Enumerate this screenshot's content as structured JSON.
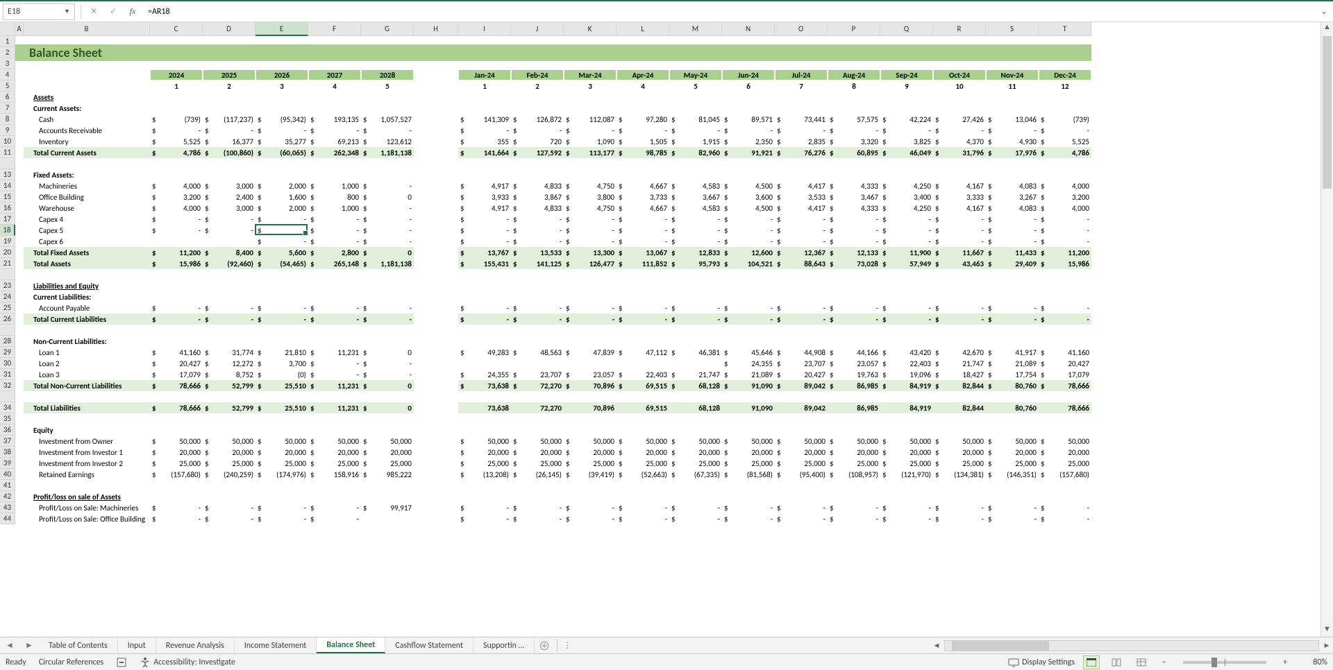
{
  "selection": {
    "cell_ref": "E18",
    "formula": "=AR18"
  },
  "column_headers": [
    "A",
    "B",
    "C",
    "D",
    "E",
    "F",
    "G",
    "H",
    "I",
    "J",
    "K",
    "L",
    "M",
    "N",
    "O",
    "P",
    "Q",
    "R",
    "S",
    "T"
  ],
  "row_headers": [
    1,
    2,
    3,
    4,
    5,
    6,
    7,
    8,
    9,
    10,
    11,
    "",
    13,
    14,
    15,
    16,
    17,
    18,
    19,
    20,
    21,
    "",
    23,
    24,
    25,
    26,
    "",
    28,
    29,
    30,
    31,
    32,
    "",
    34,
    35,
    36,
    37,
    38,
    39,
    40,
    41,
    42,
    43,
    44
  ],
  "title": "Balance Sheet",
  "yearly": {
    "headers": [
      "2024",
      "2025",
      "2026",
      "2027",
      "2028"
    ],
    "indices": [
      "1",
      "2",
      "3",
      "4",
      "5"
    ]
  },
  "monthly": {
    "headers": [
      "Jan-24",
      "Feb-24",
      "Mar-24",
      "Apr-24",
      "May-24",
      "Jun-24",
      "Jul-24",
      "Aug-24",
      "Sep-24",
      "Oct-24",
      "Nov-24",
      "Dec-24"
    ],
    "indices": [
      "1",
      "2",
      "3",
      "4",
      "5",
      "6",
      "7",
      "8",
      "9",
      "10",
      "11",
      "12"
    ]
  },
  "sections": {
    "assets": "Assets",
    "current_assets": "Current Assets:",
    "fixed_assets": "Fixed Assets:",
    "liab_eq": "Liabilities and Equity",
    "cur_liab": "Current Liabilities:",
    "noncur_liab": "Non-Current Liabilities:",
    "equity": "Equity",
    "pl_assets": "Profit/loss on sale of Assets"
  },
  "rows": [
    {
      "row": 8,
      "label": "Cash",
      "ind": 2,
      "y": [
        "(739)",
        "(117,237)",
        "(95,342)",
        "193,135",
        "1,057,527"
      ],
      "m": [
        "141,309",
        "126,872",
        "112,087",
        "97,280",
        "81,045",
        "89,571",
        "73,441",
        "57,575",
        "42,224",
        "27,426",
        "13,046",
        "(739)"
      ]
    },
    {
      "row": 9,
      "label": "Accounts Receivable",
      "ind": 2,
      "y": [
        "-",
        "-",
        "-",
        "-",
        "-"
      ],
      "m": [
        "-",
        "-",
        "-",
        "-",
        "-",
        "-",
        "-",
        "-",
        "-",
        "-",
        "-",
        "-"
      ]
    },
    {
      "row": 10,
      "label": "Inventory",
      "ind": 2,
      "y": [
        "5,525",
        "16,377",
        "35,277",
        "69,213",
        "123,612"
      ],
      "m": [
        "355",
        "720",
        "1,090",
        "1,505",
        "1,915",
        "2,350",
        "2,835",
        "3,320",
        "3,825",
        "4,370",
        "4,930",
        "5,525"
      ]
    },
    {
      "row": 11,
      "label": "Total Current Assets",
      "ind": 1,
      "sub": true,
      "y": [
        "4,786",
        "(100,860)",
        "(60,065)",
        "262,348",
        "1,181,138"
      ],
      "m": [
        "141,664",
        "127,592",
        "113,177",
        "98,785",
        "82,960",
        "91,921",
        "76,276",
        "60,895",
        "46,049",
        "31,796",
        "17,976",
        "4,786"
      ]
    },
    {
      "row": 14,
      "label": "Machineries",
      "ind": 2,
      "y": [
        "4,000",
        "3,000",
        "2,000",
        "1,000",
        "-"
      ],
      "m": [
        "4,917",
        "4,833",
        "4,750",
        "4,667",
        "4,583",
        "4,500",
        "4,417",
        "4,333",
        "4,250",
        "4,167",
        "4,083",
        "4,000"
      ]
    },
    {
      "row": 15,
      "label": "Office Building",
      "ind": 2,
      "y": [
        "3,200",
        "2,400",
        "1,600",
        "800",
        "0"
      ],
      "m": [
        "3,933",
        "3,867",
        "3,800",
        "3,733",
        "3,667",
        "3,600",
        "3,533",
        "3,467",
        "3,400",
        "3,333",
        "3,267",
        "3,200"
      ]
    },
    {
      "row": 16,
      "label": "Warehouse",
      "ind": 2,
      "y": [
        "4,000",
        "3,000",
        "2,000",
        "1,000",
        "-"
      ],
      "m": [
        "4,917",
        "4,833",
        "4,750",
        "4,667",
        "4,583",
        "4,500",
        "4,417",
        "4,333",
        "4,250",
        "4,167",
        "4,083",
        "4,000"
      ]
    },
    {
      "row": 17,
      "label": "Capex 4",
      "ind": 2,
      "y": [
        "-",
        "-",
        "-",
        "-",
        "-"
      ],
      "m": [
        "-",
        "-",
        "-",
        "-",
        "-",
        "-",
        "-",
        "-",
        "-",
        "-",
        "-",
        "-"
      ]
    },
    {
      "row": 18,
      "label": "Capex 5",
      "ind": 2,
      "y": [
        "-",
        "-",
        "-",
        "-",
        "-"
      ],
      "m": [
        "-",
        "-",
        "-",
        "-",
        "-",
        "-",
        "-",
        "-",
        "-",
        "-",
        "-",
        "-"
      ]
    },
    {
      "row": 19,
      "label": "Capex 6",
      "ind": 2,
      "y": [
        "",
        "",
        "-",
        "-",
        "-"
      ],
      "m": [
        "-",
        "-",
        "-",
        "-",
        "-",
        "-",
        "-",
        "-",
        "-",
        "-",
        "-",
        "-"
      ],
      "no_dollar_y": [
        0,
        1
      ]
    },
    {
      "row": 20,
      "label": "Total Fixed Assets",
      "ind": 1,
      "sub": true,
      "y": [
        "11,200",
        "8,400",
        "5,600",
        "2,800",
        "0"
      ],
      "m": [
        "13,767",
        "13,533",
        "13,300",
        "13,067",
        "12,833",
        "12,600",
        "12,367",
        "12,133",
        "11,900",
        "11,667",
        "11,433",
        "11,200"
      ]
    },
    {
      "row": 21,
      "label": "Total Assets",
      "ind": 1,
      "sub": true,
      "y": [
        "15,986",
        "(92,460)",
        "(54,465)",
        "265,148",
        "1,181,138"
      ],
      "m": [
        "155,431",
        "141,125",
        "126,477",
        "111,852",
        "95,793",
        "104,521",
        "88,643",
        "73,028",
        "57,949",
        "43,463",
        "29,409",
        "15,986"
      ]
    },
    {
      "row": 25,
      "label": "Account Payable",
      "ind": 2,
      "y": [
        "-",
        "-",
        "-",
        "-",
        "-"
      ],
      "m": [
        "-",
        "-",
        "-",
        "-",
        "-",
        "-",
        "-",
        "-",
        "-",
        "-",
        "-",
        "-"
      ]
    },
    {
      "row": 26,
      "label": "Total Current Liabilities",
      "ind": 1,
      "sub": true,
      "y": [
        "-",
        "-",
        "-",
        "-",
        "-"
      ],
      "m": [
        "-",
        "-",
        "-",
        "-",
        "-",
        "-",
        "-",
        "-",
        "-",
        "-",
        "-",
        "-"
      ]
    },
    {
      "row": 29,
      "label": "Loan 1",
      "ind": 2,
      "y": [
        "41,160",
        "31,774",
        "21,810",
        "11,231",
        "0"
      ],
      "m": [
        "49,283",
        "48,563",
        "47,839",
        "47,112",
        "46,381",
        "45,646",
        "44,908",
        "44,166",
        "43,420",
        "42,670",
        "41,917",
        "41,160"
      ]
    },
    {
      "row": 30,
      "label": "Loan 2",
      "ind": 2,
      "y": [
        "20,427",
        "12,272",
        "3,700",
        "-",
        "-"
      ],
      "m": [
        "",
        "",
        "",
        "",
        "",
        "24,355",
        "23,707",
        "23,057",
        "22,403",
        "21,747",
        "21,089",
        "20,427"
      ]
    },
    {
      "row": 31,
      "label": "Loan 3",
      "ind": 2,
      "y": [
        "17,079",
        "8,752",
        "(0)",
        "-",
        "-"
      ],
      "m": [
        "24,355",
        "23,707",
        "23,057",
        "22,403",
        "21,747",
        "21,089",
        "20,427",
        "19,763",
        "19,096",
        "18,427",
        "17,754",
        "17,079"
      ]
    },
    {
      "row": 32,
      "label": "Total Non-Current Liabilities",
      "ind": 1,
      "sub": true,
      "y": [
        "78,666",
        "52,799",
        "25,510",
        "11,231",
        "0"
      ],
      "m": [
        "73,638",
        "72,270",
        "70,896",
        "69,515",
        "68,128",
        "91,090",
        "89,042",
        "86,985",
        "84,919",
        "82,844",
        "80,760",
        "78,666"
      ]
    },
    {
      "row": 34,
      "label": "Total Liabilities",
      "ind": 1,
      "sub": true,
      "no_dollar_m": true,
      "y": [
        "78,666",
        "52,799",
        "25,510",
        "11,231",
        "0"
      ],
      "m": [
        "73,638",
        "72,270",
        "70,896",
        "69,515",
        "68,128",
        "91,090",
        "89,042",
        "86,985",
        "84,919",
        "82,844",
        "80,760",
        "78,666"
      ]
    },
    {
      "row": 37,
      "label": "Investment from Owner",
      "ind": 2,
      "y": [
        "50,000",
        "50,000",
        "50,000",
        "50,000",
        "50,000"
      ],
      "m": [
        "50,000",
        "50,000",
        "50,000",
        "50,000",
        "50,000",
        "50,000",
        "50,000",
        "50,000",
        "50,000",
        "50,000",
        "50,000",
        "50,000"
      ]
    },
    {
      "row": 38,
      "label": "Investment from Investor 1",
      "ind": 2,
      "y": [
        "20,000",
        "20,000",
        "20,000",
        "20,000",
        "20,000"
      ],
      "m": [
        "20,000",
        "20,000",
        "20,000",
        "20,000",
        "20,000",
        "20,000",
        "20,000",
        "20,000",
        "20,000",
        "20,000",
        "20,000",
        "20,000"
      ]
    },
    {
      "row": 39,
      "label": "Investment from Investor 2",
      "ind": 2,
      "y": [
        "25,000",
        "25,000",
        "25,000",
        "25,000",
        "25,000"
      ],
      "m": [
        "25,000",
        "25,000",
        "25,000",
        "25,000",
        "25,000",
        "25,000",
        "25,000",
        "25,000",
        "25,000",
        "25,000",
        "25,000",
        "25,000"
      ]
    },
    {
      "row": 40,
      "label": "Retained Earnings",
      "ind": 2,
      "y": [
        "(157,680)",
        "(240,259)",
        "(174,976)",
        "158,916",
        "985,222"
      ],
      "m": [
        "(13,208)",
        "(26,145)",
        "(39,419)",
        "(52,663)",
        "(67,335)",
        "(81,568)",
        "(95,400)",
        "(108,957)",
        "(121,970)",
        "(134,381)",
        "(146,351)",
        "(157,680)"
      ]
    },
    {
      "row": 43,
      "label": "Profit/Loss on Sale: Machineries",
      "ind": 2,
      "y": [
        "-",
        "-",
        "-",
        "-",
        "99,917"
      ],
      "m": [
        "-",
        "-",
        "-",
        "-",
        "-",
        "-",
        "-",
        "-",
        "-",
        "-",
        "-",
        "-"
      ]
    },
    {
      "row": 44,
      "label": "Profit/Loss on Sale: Office Building",
      "ind": 2,
      "y": [
        "-",
        "-",
        "-",
        "-",
        ""
      ],
      "m": [
        "-",
        "-",
        "-",
        "-",
        "-",
        "-",
        "-",
        "-",
        "-",
        "-",
        "-",
        "-"
      ]
    }
  ],
  "free_labels": [
    {
      "row": 6,
      "text": "Assets",
      "cls": "bold under indent1"
    },
    {
      "row": 7,
      "text": "Current Assets:",
      "cls": "bold indent1"
    },
    {
      "row": 13,
      "text": "Fixed Assets:",
      "cls": "bold indent1"
    },
    {
      "row": 23,
      "text": "Liabilities and Equity",
      "cls": "bold under indent1"
    },
    {
      "row": 24,
      "text": "Current Liabilities:",
      "cls": "bold indent1"
    },
    {
      "row": 28,
      "text": "Non-Current Liabilities:",
      "cls": "bold indent1"
    },
    {
      "row": 36,
      "text": "Equity",
      "cls": "bold indent1"
    },
    {
      "row": 42,
      "text": "Profit/loss on sale of Assets",
      "cls": "bold under indent1"
    }
  ],
  "tabs": [
    "Table of Contents",
    "Input",
    "Revenue Analysis",
    "Income Statement",
    "Balance Sheet",
    "Cashflow Statement",
    "Supportin …"
  ],
  "active_tab": "Balance Sheet",
  "status": {
    "ready": "Ready",
    "circ": "Circular References",
    "acc": "Accessibility: Investigate",
    "disp": "Display Settings",
    "zoom": "80%"
  }
}
